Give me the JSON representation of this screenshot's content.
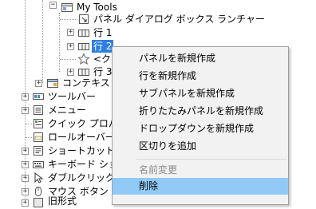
{
  "tree": {
    "my_tools": "My Tools",
    "panel_launcher": "パネル ダイアログ ボックス ランチャー",
    "row1": "行 1",
    "row2": "行 2",
    "clipped_item": "<クス",
    "row3": "行 3",
    "context": "コンテキスト",
    "toolbar": "ツールバー",
    "menu": "メニュー",
    "quick_props": "クイック プロパティ",
    "rollover": "ロールオーバー ツ",
    "shortcut": "ショートカット メニ",
    "keyboard": "キーボード ショー",
    "double_click": "ダブルクリック ア",
    "mouse_button": "マウス ボタン",
    "legacy": "旧形式"
  },
  "context_menu": {
    "new_panel": "パネルを新規作成",
    "new_row": "行を新規作成",
    "new_subpanel": "サブパネルを新規作成",
    "new_foldout": "折りたたみパネルを新規作成",
    "new_dropdown": "ドロップダウンを新規作成",
    "add_separator": "区切りを追加",
    "rename": "名前変更",
    "delete": "削除"
  }
}
